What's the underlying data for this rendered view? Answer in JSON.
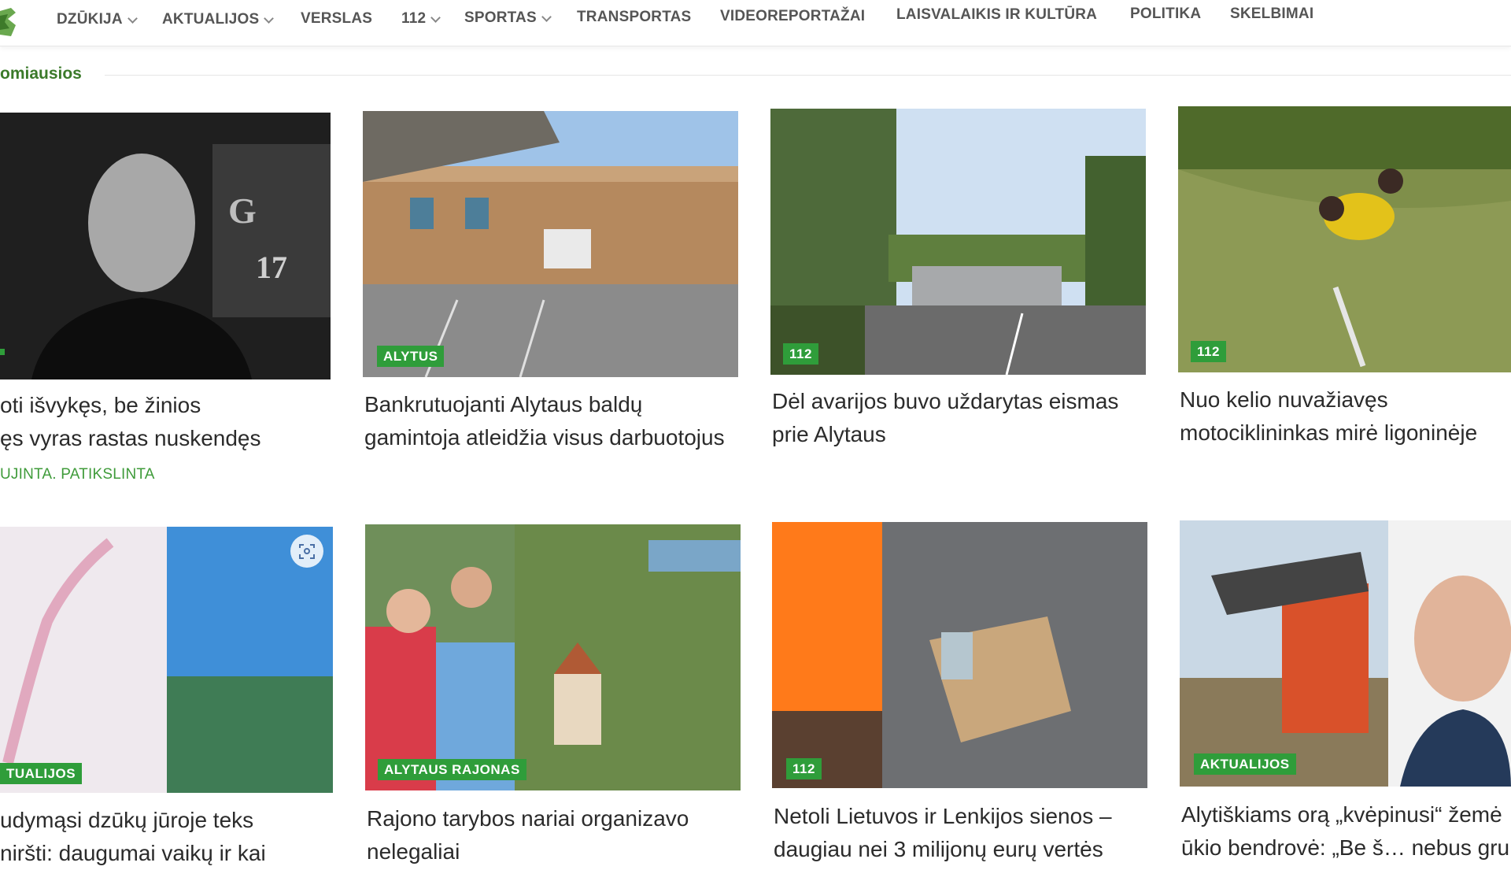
{
  "nav": {
    "items": [
      {
        "label": "DZŪKIJA",
        "dropdown": true
      },
      {
        "label": "AKTUALIJOS",
        "dropdown": true
      },
      {
        "label": "VERSLAS",
        "dropdown": false
      },
      {
        "label": "112",
        "dropdown": true
      },
      {
        "label": "SPORTAS",
        "dropdown": true
      },
      {
        "label": "TRANSPORTAS",
        "dropdown": false
      },
      {
        "label": "VIDEOREPORTAŽAI",
        "dropdown": false
      },
      {
        "label": "LAISVALAIKIS IR KULTŪRA",
        "dropdown": false
      },
      {
        "label": "POLITIKA",
        "dropdown": false
      },
      {
        "label": "SKELBIMAI",
        "dropdown": false
      }
    ]
  },
  "section": {
    "title": "omiausios"
  },
  "articles": [
    {
      "badge": "",
      "lines": [
        "oti išvykęs, be žinios",
        "ęs vyras rastas nuskendęs"
      ],
      "tag": "UJINTA. PATIKSLINTA"
    },
    {
      "badge": "ALYTUS",
      "lines": [
        "Bankrutuojanti Alytaus baldų",
        "gamintoja atleidžia visus darbuotojus"
      ]
    },
    {
      "badge": "112",
      "lines": [
        "Dėl avarijos buvo uždarytas eismas",
        "prie Alytaus"
      ]
    },
    {
      "badge": "112",
      "lines": [
        "Nuo kelio nuvažiavęs",
        "motociklininkas mirė ligoninėje"
      ]
    },
    {
      "badge": "TUALIJOS",
      "lines": [
        "udymąsi dzūkų jūroje teks",
        "niršti: daugumai vaikų ir kai"
      ]
    },
    {
      "badge": "ALYTAUS RAJONAS",
      "lines": [
        "Rajono tarybos nariai organizavo",
        "nelegaliai"
      ]
    },
    {
      "badge": "112",
      "lines": [
        "Netoli Lietuvos ir Lenkijos sienos –",
        "daugiau nei 3 milijonų eurų vertės"
      ]
    },
    {
      "badge": "AKTUALIJOS",
      "lines": [
        "Alytiškiams orą „kvėpinusi“ žemė",
        "ūkio bendrovė: „Be š… nebus gru"
      ]
    }
  ],
  "colors": {
    "accent": "#2f9d3a",
    "section_title": "#3b7a2a",
    "tag": "#3f9b3a"
  },
  "icons": {
    "scan": "visual-search-icon",
    "dropdown": "chevron-down-icon"
  }
}
